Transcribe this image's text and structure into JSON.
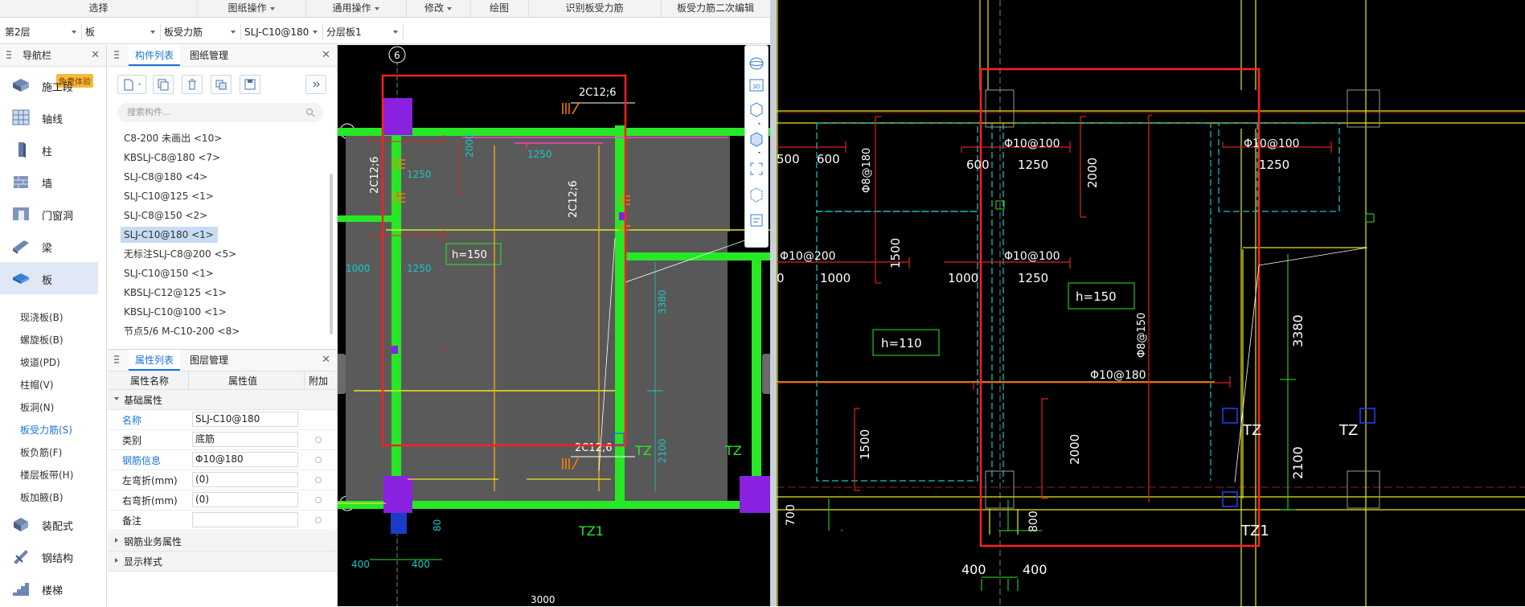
{
  "ribbon": {
    "tabs": [
      {
        "label": "选择",
        "dropdown": false
      },
      {
        "label": "图纸操作",
        "dropdown": true
      },
      {
        "label": "通用操作",
        "dropdown": true
      },
      {
        "label": "修改",
        "dropdown": true
      },
      {
        "label": "绘图",
        "dropdown": false
      },
      {
        "label": "识别板受力筋",
        "dropdown": false
      },
      {
        "label": "板受力筋二次编辑",
        "dropdown": false
      }
    ]
  },
  "selectors": [
    {
      "value": "第2层"
    },
    {
      "value": "板"
    },
    {
      "value": "板受力筋"
    },
    {
      "value": "SLJ-C10@180"
    },
    {
      "value": "分层板1"
    }
  ],
  "nav": {
    "title": "导航栏",
    "badge": "免费体验",
    "items": [
      {
        "label": "施工段",
        "icon": "construction-segment-icon"
      },
      {
        "label": "轴线",
        "icon": "grid-axis-icon"
      },
      {
        "label": "柱",
        "icon": "column-icon"
      },
      {
        "label": "墙",
        "icon": "wall-icon"
      },
      {
        "label": "门窗洞",
        "icon": "door-window-icon"
      },
      {
        "label": "梁",
        "icon": "beam-icon"
      },
      {
        "label": "板",
        "icon": "slab-icon"
      }
    ],
    "sub_items": [
      {
        "label": "现浇板(B)"
      },
      {
        "label": "螺旋板(B)"
      },
      {
        "label": "坡道(PD)"
      },
      {
        "label": "柱帽(V)"
      },
      {
        "label": "板洞(N)"
      },
      {
        "label": "板受力筋(S)"
      },
      {
        "label": "板负筋(F)"
      },
      {
        "label": "楼层板带(H)"
      },
      {
        "label": "板加腋(B)"
      }
    ],
    "items2": [
      {
        "label": "装配式",
        "icon": "prefab-icon"
      },
      {
        "label": "钢结构",
        "icon": "steel-structure-icon"
      },
      {
        "label": "楼梯",
        "icon": "stair-icon"
      }
    ],
    "active_sub": "板受力筋(S)"
  },
  "component_list": {
    "tabs": [
      "构件列表",
      "图纸管理"
    ],
    "search_placeholder": "搜索构件...",
    "items": [
      "C8-200 未画出 <10>",
      "KBSLJ-C8@180 <7>",
      "SLJ-C8@180 <4>",
      "SLJ-C10@125 <1>",
      "SLJ-C8@150 <2>",
      "SLJ-C10@180 <1>",
      "无标注SLJ-C8@200 <5>",
      "SLJ-C10@150 <1>",
      "KBSLJ-C12@125 <1>",
      "KBSLJ-C10@100 <1>",
      "节点5/6 M-C10-200 <8>"
    ],
    "selected": "SLJ-C10@180 <1>"
  },
  "properties": {
    "tabs": [
      "属性列表",
      "图层管理"
    ],
    "columns": [
      "属性名称",
      "属性值",
      "附加"
    ],
    "section_basic": "基础属性",
    "rows": [
      {
        "name": "名称",
        "value": "SLJ-C10@180",
        "highlight": true
      },
      {
        "name": "类别",
        "value": "底筋",
        "highlight": false
      },
      {
        "name": "钢筋信息",
        "value": "Φ10@180",
        "highlight": true
      },
      {
        "name": "左弯折(mm)",
        "value": "(0)",
        "highlight": false
      },
      {
        "name": "右弯折(mm)",
        "value": "(0)",
        "highlight": false
      },
      {
        "name": "备注",
        "value": "",
        "highlight": false
      }
    ],
    "section_business": "钢筋业务属性",
    "section_display": "显示样式"
  },
  "cad_left": {
    "axis_6": "6",
    "axis_B": "B",
    "axis_A": "A",
    "labels": {
      "top_rebar": "2C12;6",
      "mid_rebar": "2C12;6",
      "left_rebar": "2C12;6",
      "bottom_rebar": "2C12;6",
      "h150": "h=150",
      "tz": "TZ",
      "tz1": "TZ1",
      "dim_400a": "400",
      "dim_400b": "400",
      "dim_3380": "3380",
      "dim_2100": "2100",
      "dim_80": "80",
      "dim_1250a": "1250",
      "dim_1250b": "1250",
      "dim_1250c": "1250",
      "dim_1000": "1000",
      "dim_2000": "2000",
      "dim_bottom": "3000"
    }
  },
  "cad_right": {
    "labels": {
      "r1": "Φ10@100",
      "r2": "Φ10@100",
      "r3": "Φ10@100",
      "r4": "Φ10@200",
      "r5": "Φ10@180",
      "r6": "Φ8@180",
      "r7": "Φ8@150",
      "d500": "500",
      "d600a": "600",
      "d600b": "600",
      "d1250a": "1250",
      "d1250b": "1250",
      "d1250c": "1250",
      "d2000a": "2000",
      "d2000b": "2000",
      "d1500a": "1500",
      "d1500b": "1500",
      "d1000a": "1000",
      "d1000b": "1000",
      "d0": "0",
      "h150": "h=150",
      "h110": "h=110",
      "d3380": "3380",
      "d2100": "2100",
      "tz_a": "TZ",
      "tz_b": "TZ",
      "tz1": "TZ1",
      "d700": "700",
      "d800": "800",
      "d400a": "400",
      "d400b": "400"
    }
  },
  "colors": {
    "accent": "#1a73d9",
    "cad_bg": "#000000",
    "slab_gray": "#5a5a5a",
    "beam_green": "#27e827",
    "red_frame": "#ff2020",
    "cyan": "#18c8c8",
    "yellow": "#e8e820"
  }
}
